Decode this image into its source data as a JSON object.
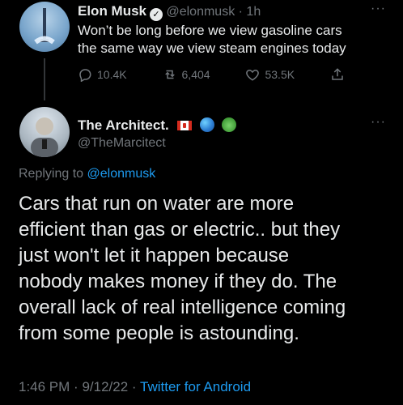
{
  "header_tweet": {
    "author_name": "Elon Musk",
    "verified_badge": "✓",
    "handle": "@elonmusk",
    "separator": "·",
    "time": "1h",
    "text_line1": "Won’t be long before we view gasoline cars",
    "text_line2": "the same way we view steam engines today",
    "replies": "10.4K",
    "retweets": "6,404",
    "likes": "53.5K",
    "more": "···"
  },
  "reply_tweet": {
    "author_name": "The Architect.",
    "handle": "@TheMarcitect",
    "more": "···",
    "replying_to_prefix": "Replying to",
    "replying_to_handle": "@elonmusk",
    "body_lines": [
      "Cars that run on water are more",
      "efficient than gas or electric.. but they",
      "just won't let it happen because",
      "nobody makes money if they do. The",
      "overall lack of real intelligence coming",
      "from some people is astounding."
    ],
    "meta_time": "1:46 PM",
    "meta_sep1": "·",
    "meta_date": "9/12/22",
    "meta_sep2": "·",
    "meta_source": "Twitter for Android"
  },
  "icons": {
    "reply": "reply-icon",
    "retweet": "retweet-icon",
    "like": "heart-icon",
    "share": "share-icon"
  },
  "colors": {
    "background": "#000000",
    "primary_text": "#e7e9ea",
    "secondary_text": "#71767b",
    "link": "#1d9bf0"
  }
}
